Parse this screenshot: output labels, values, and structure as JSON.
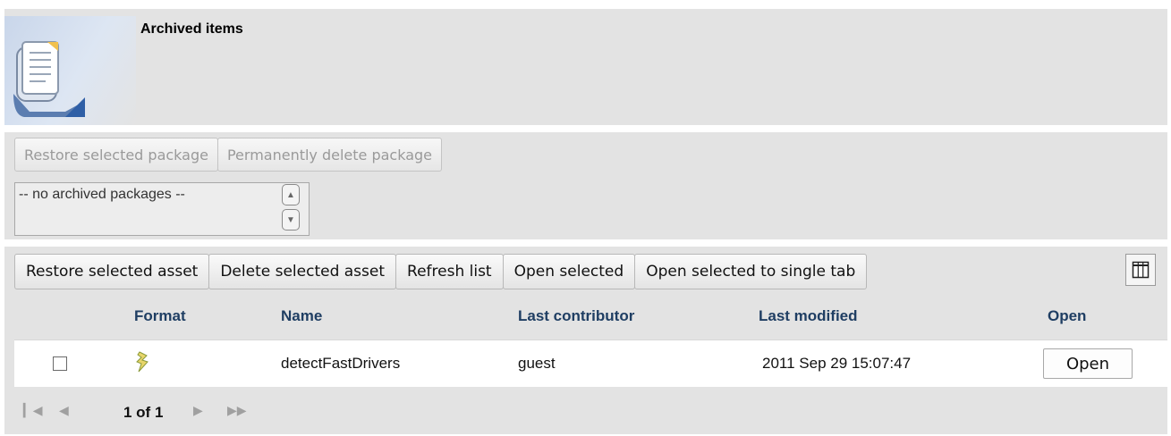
{
  "header": {
    "title": "Archived items",
    "icon": "archive-document-icon"
  },
  "packages": {
    "restore_label": "Restore selected package",
    "delete_label": "Permanently delete package",
    "list_value": "-- no archived packages --"
  },
  "assets": {
    "toolbar": {
      "restore_label": "Restore selected asset",
      "delete_label": "Delete selected asset",
      "refresh_label": "Refresh list",
      "open_label": "Open selected",
      "open_single_label": "Open selected to single tab",
      "columns_icon": "column-picker-icon"
    },
    "columns": {
      "format": "Format",
      "name": "Name",
      "last_contributor": "Last contributor",
      "last_modified": "Last modified",
      "open": "Open"
    },
    "rows": [
      {
        "format_icon": "rule-asset-icon",
        "name": "detectFastDrivers",
        "last_contributor": "guest",
        "last_modified": "2011 Sep 29 15:07:47",
        "open_label": "Open"
      }
    ],
    "pager": {
      "text": "1 of 1"
    }
  },
  "colors": {
    "panel_bg": "#e3e3e3",
    "header_text": "#1f3e63",
    "disabled_text": "#9a9a9a"
  }
}
